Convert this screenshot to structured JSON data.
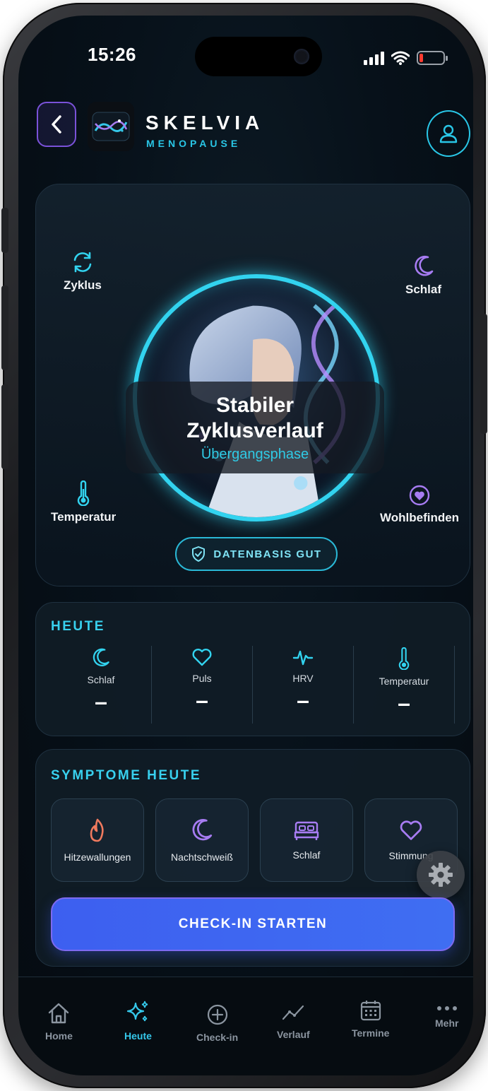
{
  "status": {
    "time": "15:26"
  },
  "header": {
    "brand_name": "SKELVIA",
    "brand_sub": "MENOPAUSE"
  },
  "hero": {
    "metrics": {
      "cycle": "Zyklus",
      "sleep": "Schlaf",
      "temperature": "Temperatur",
      "wellbeing": "Wohlbefinden"
    },
    "title": "Stabiler Zyklusverlauf",
    "phase": "Übergangsphase",
    "data_badge": "DATENBASIS GUT"
  },
  "today": {
    "label": "HEUTE",
    "items": [
      {
        "label": "Schlaf",
        "value": "–",
        "icon": "moon-icon"
      },
      {
        "label": "Puls",
        "value": "–",
        "icon": "heart-icon"
      },
      {
        "label": "HRV",
        "value": "–",
        "icon": "pulse-icon"
      },
      {
        "label": "Temperatur",
        "value": "–",
        "icon": "thermometer-icon"
      }
    ]
  },
  "symptoms": {
    "label": "SYMPTOME HEUTE",
    "items": [
      {
        "label": "Hitzewallungen",
        "icon": "flame-icon"
      },
      {
        "label": "Nachtschweiß",
        "icon": "moon-icon"
      },
      {
        "label": "Schlaf",
        "icon": "bed-icon"
      },
      {
        "label": "Stimmung",
        "icon": "heart-icon"
      }
    ],
    "cta": "CHECK-IN STARTEN"
  },
  "tabs": {
    "home": "Home",
    "today": "Heute",
    "checkin": "Check-in",
    "verlauf": "Verlauf",
    "termine": "Termine",
    "mehr": "Mehr"
  },
  "colors": {
    "accent_cyan": "#32d3ef",
    "accent_purple": "#a77cf2",
    "cta_blue": "#3d5ff0",
    "flame": "#f07a5e"
  }
}
